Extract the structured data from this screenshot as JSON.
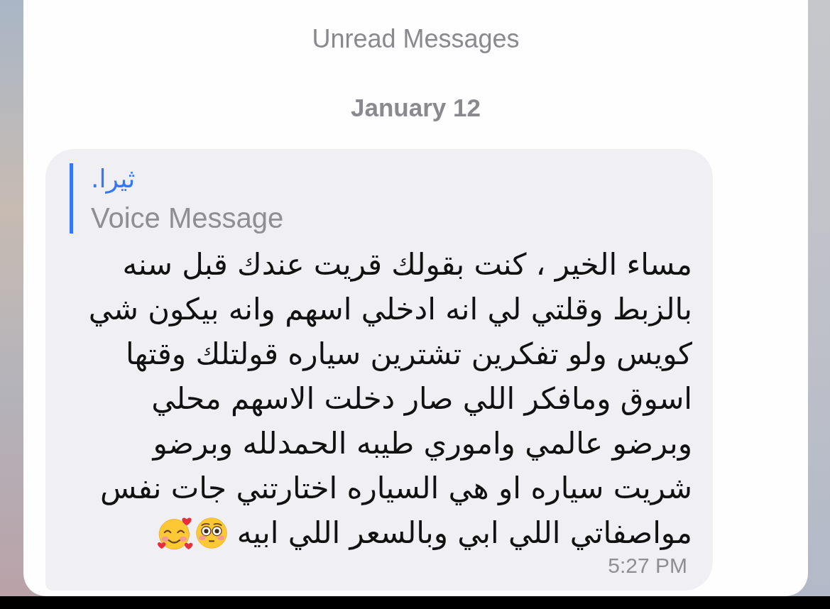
{
  "unread_divider": {
    "label": "Unread Messages"
  },
  "date_header": {
    "label": "January 12"
  },
  "message": {
    "reply": {
      "sender": "ثيرا.",
      "preview": "Voice Message"
    },
    "text_lines": [
      "مساء الخير ، كنت بقولك قريت عندك قبل سنه",
      "بالزبط وقلتي لي انه ادخلي اسهم وانه بيكون شي",
      "كويس ولو تفكرين تشترين سياره قولتلك وقتها",
      "اسوق ومافكر اللي صار دخلت الاسهم محلي",
      "وبرضو عالمي واموري طيبه الحمدلله وبرضو",
      "شريت سياره او هي السياره اختارتني جات نفس",
      "مواصفاتي اللي ابي وبالسعر اللي ابيه"
    ],
    "time": "5:27 PM"
  }
}
